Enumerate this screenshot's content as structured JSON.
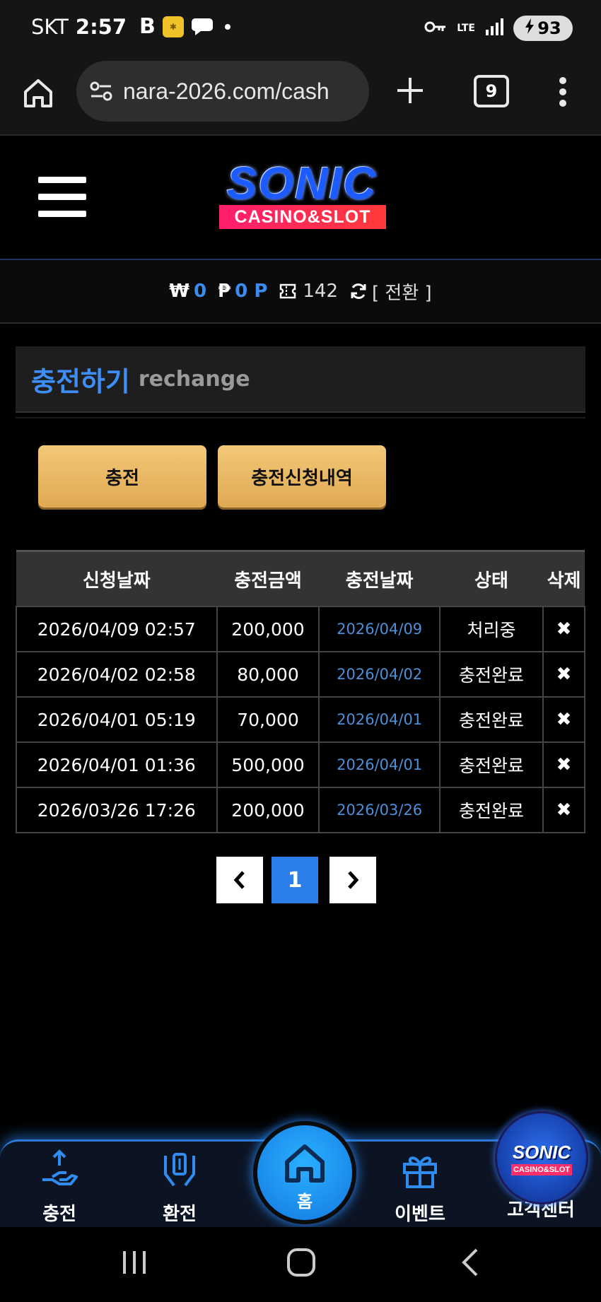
{
  "status_bar": {
    "carrier": "SKT",
    "time": "2:57",
    "network": "LTE",
    "battery": "93"
  },
  "browser": {
    "url": "nara-2026.com/cash",
    "tab_count": "9"
  },
  "site": {
    "logo_title": "SONIC",
    "logo_subtitle": "CASINO&SLOT"
  },
  "balance": {
    "won_symbol": "₩",
    "won_value": "0",
    "point_symbol": "₱",
    "point_value": "0 P",
    "ticket_count": "142",
    "switch_label": "[ 전환 ]"
  },
  "page": {
    "title": "충전하기",
    "subtitle": "rechange"
  },
  "actions": {
    "charge_label": "충전",
    "history_label": "충전신청내역"
  },
  "table": {
    "headers": [
      "신청날짜",
      "충전금액",
      "충전날짜",
      "상태",
      "삭제"
    ],
    "rows": [
      {
        "request_date": "2026/04/09 02:57",
        "amount": "200,000",
        "charge_date": "2026/04/09",
        "status": "처리중",
        "delete": "✖"
      },
      {
        "request_date": "2026/04/02 02:58",
        "amount": "80,000",
        "charge_date": "2026/04/02",
        "status": "충전완료",
        "delete": "✖"
      },
      {
        "request_date": "2026/04/01 05:19",
        "amount": "70,000",
        "charge_date": "2026/04/01",
        "status": "충전완료",
        "delete": "✖"
      },
      {
        "request_date": "2026/04/01 01:36",
        "amount": "500,000",
        "charge_date": "2026/04/01",
        "status": "충전완료",
        "delete": "✖"
      },
      {
        "request_date": "2026/03/26 17:26",
        "amount": "200,000",
        "charge_date": "2026/03/26",
        "status": "충전완료",
        "delete": "✖"
      }
    ]
  },
  "pagination": {
    "current_page": "1"
  },
  "bottom_nav": {
    "charge": "충전",
    "exchange": "환전",
    "home": "홈",
    "event": "이벤트",
    "support": "고객센터"
  },
  "colors": {
    "accent_blue": "#3e8ef7",
    "gold_button": "#e8b767",
    "nav_glow": "#2a79d6"
  }
}
